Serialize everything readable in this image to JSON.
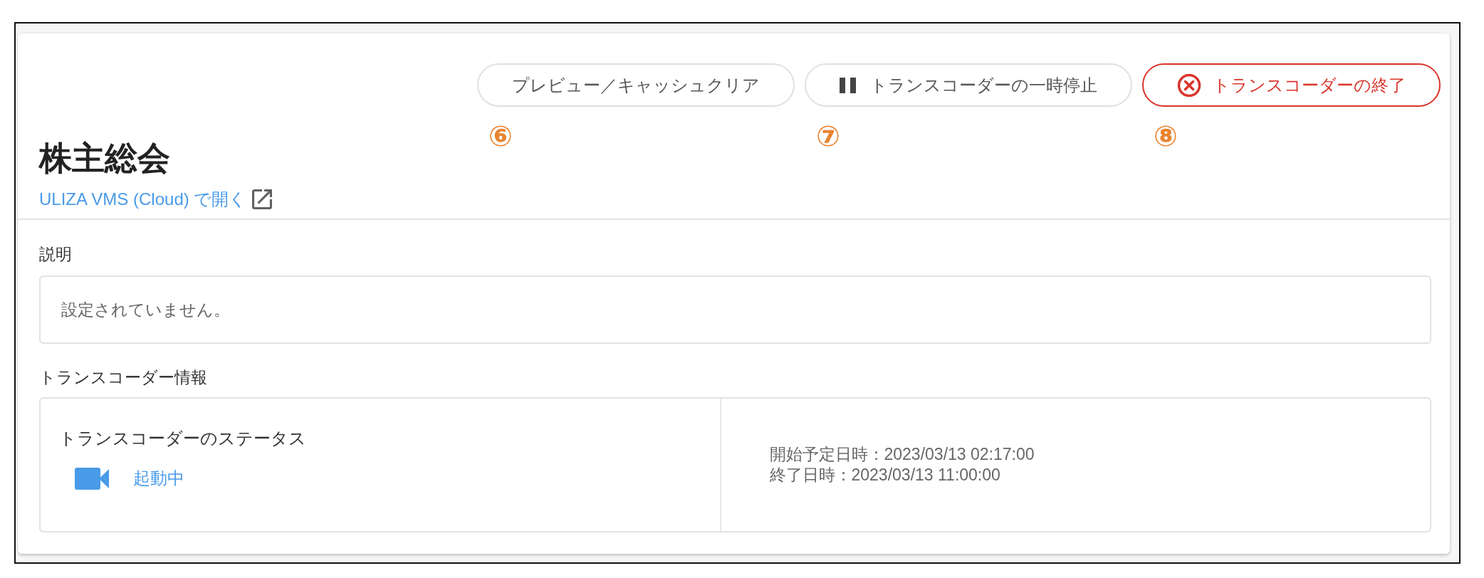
{
  "toolbar": {
    "buttons": [
      {
        "kind": "plain",
        "label": "プレビュー／キャッシュクリア",
        "callout": "⑥"
      },
      {
        "kind": "pause",
        "label": "トランスコーダーの一時停止",
        "callout": "⑦"
      },
      {
        "kind": "danger",
        "label": "トランスコーダーの終了",
        "callout": "⑧"
      }
    ]
  },
  "header": {
    "title": "株主総会",
    "link": {
      "label": "ULIZA VMS (Cloud) で開く"
    }
  },
  "description": {
    "label": "説明",
    "text": "設定されていません。"
  },
  "transcoder_info": {
    "label": "トランスコーダー情報",
    "status": {
      "label": "トランスコーダーのステータス",
      "kind": "running",
      "value": "起動中"
    },
    "schedule": [
      "開始予定日時：2023/03/13 02:17:00",
      "終了日時：2023/03/13 11:00:00"
    ]
  }
}
